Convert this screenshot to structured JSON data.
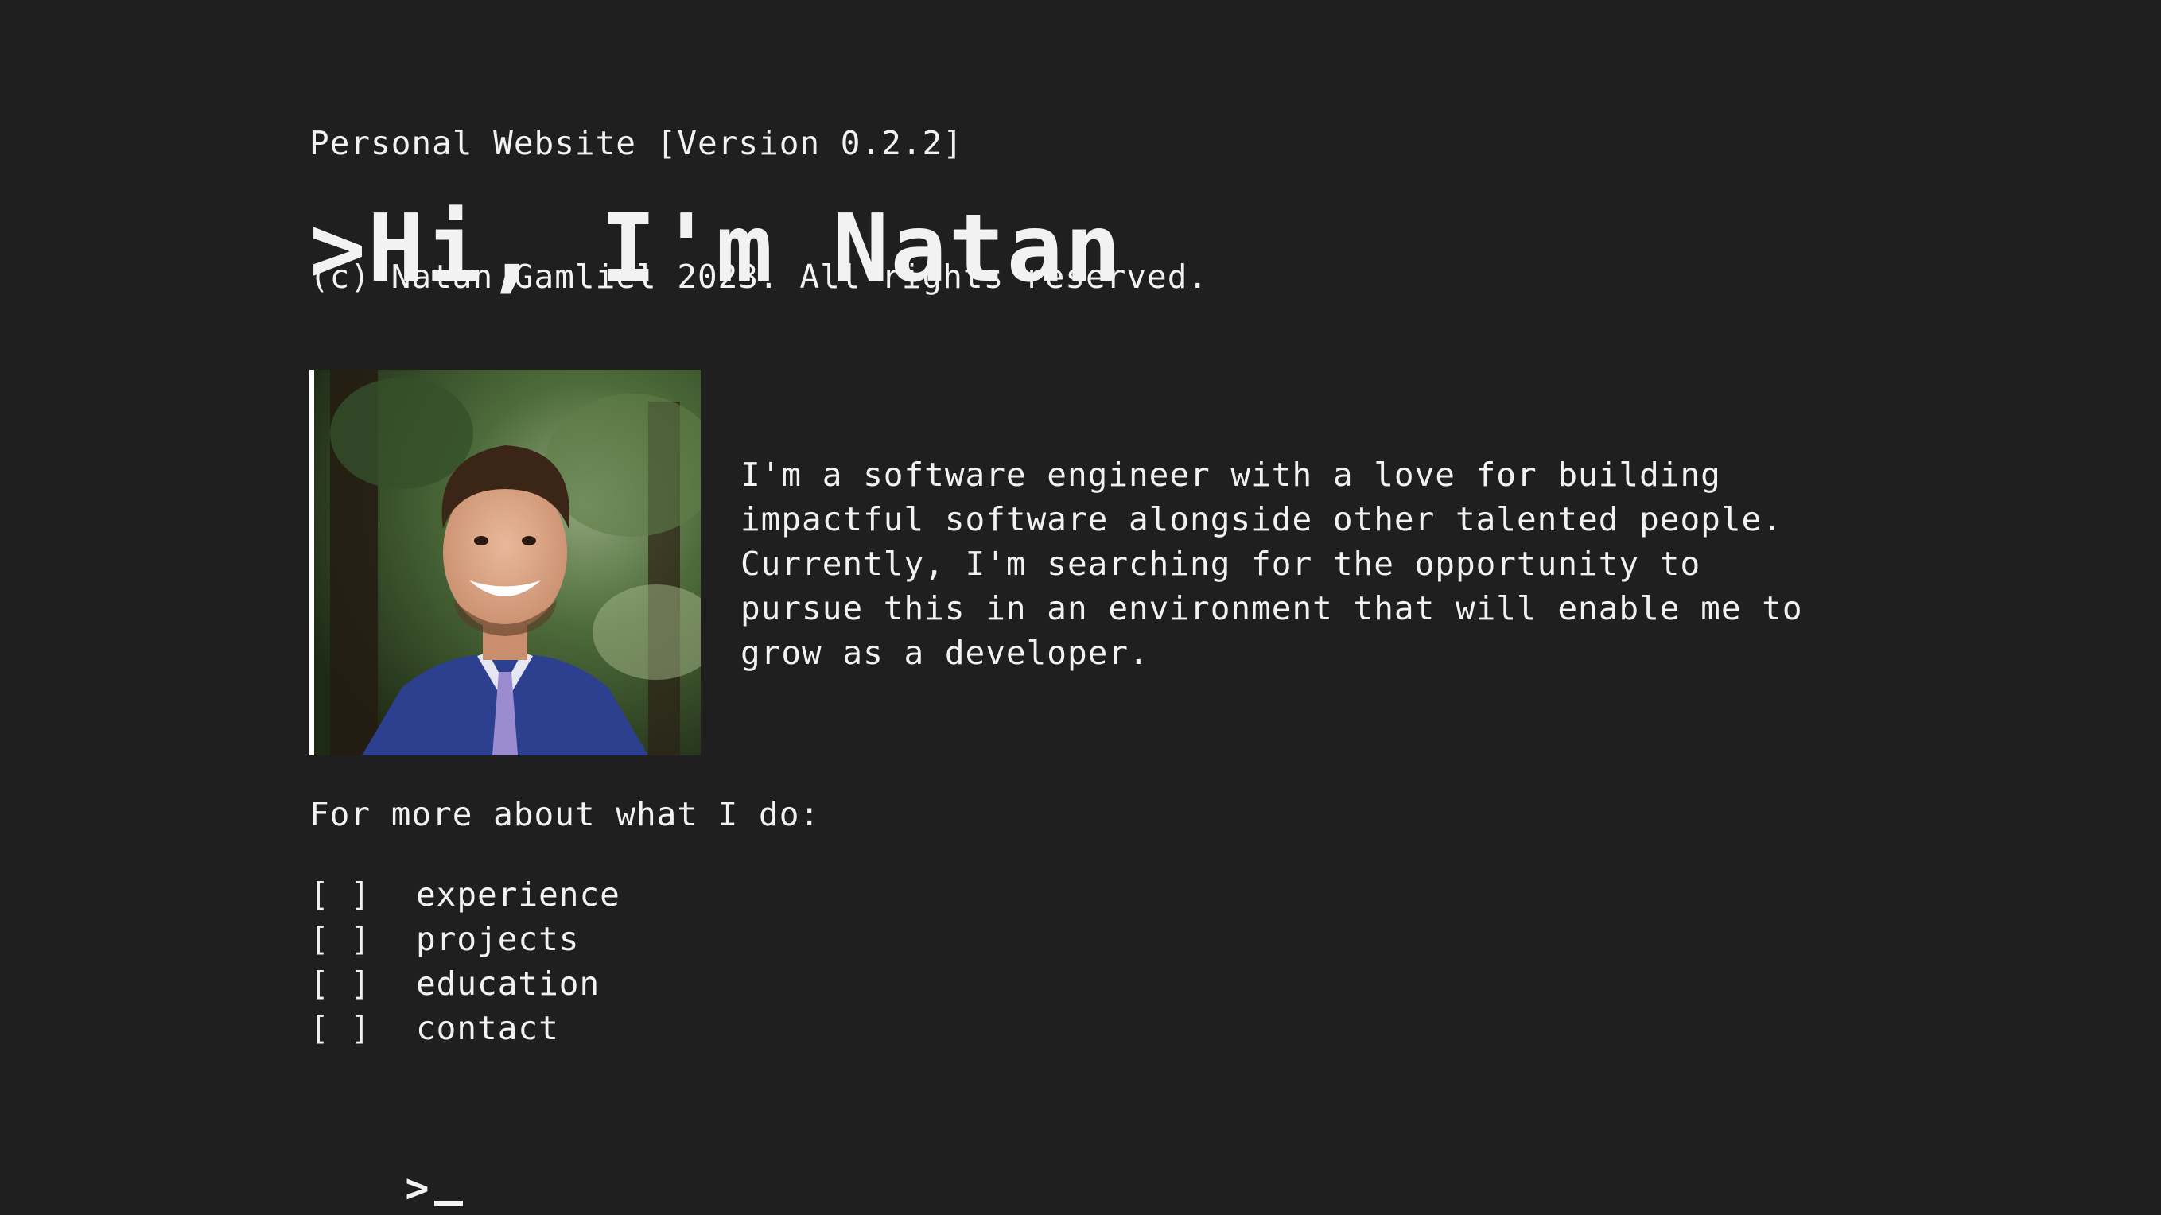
{
  "header": {
    "line1": "Personal Website [Version 0.2.2]",
    "line2": "(c) Natan Gamliel 2023. All rights reserved."
  },
  "hero": {
    "title": ">Hi, I'm Natan"
  },
  "profile": {
    "photo_alt": "portrait photo"
  },
  "bio": {
    "lines": [
      "I'm a software engineer with a love for building",
      "impactful software alongside other talented people.",
      "Currently, I'm searching for the opportunity to",
      "pursue this in an environment that will enable me to",
      "grow as a developer."
    ]
  },
  "more": {
    "text": "For more about what I do:"
  },
  "menu": {
    "items": [
      {
        "box": "[ ]",
        "label": "experience"
      },
      {
        "box": "[ ]",
        "label": "projects"
      },
      {
        "box": "[ ]",
        "label": "education"
      },
      {
        "box": "[ ]",
        "label": "contact"
      }
    ]
  },
  "prompt": {
    "symbol": ">"
  },
  "colors": {
    "background": "#1f1f1f",
    "text": "#f2f2f2",
    "suit": "#2d3f8f"
  }
}
